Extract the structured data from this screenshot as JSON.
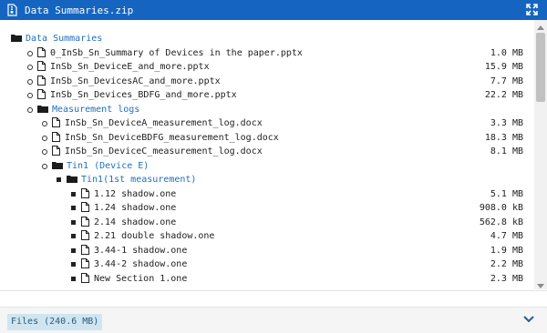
{
  "window": {
    "title": "Data Summaries.zip"
  },
  "tree": [
    {
      "name": "Data Summaries",
      "type": "folder",
      "level": 0
    },
    {
      "name": "0_InSb_Sn_Summary of Devices in the paper.pptx",
      "type": "file",
      "level": 1,
      "size": "1.0 MB"
    },
    {
      "name": "InSb_Sn_DeviceE_and_more.pptx",
      "type": "file",
      "level": 1,
      "size": "15.9 MB"
    },
    {
      "name": "InSb_Sn_DevicesAC_and_more.pptx",
      "type": "file",
      "level": 1,
      "size": "7.7 MB"
    },
    {
      "name": "InSb_Sn_Devices_BDFG_and_more.pptx",
      "type": "file",
      "level": 1,
      "size": "22.2 MB"
    },
    {
      "name": "Measurement logs",
      "type": "folder",
      "level": 1
    },
    {
      "name": "InSb_Sn_DeviceA_measurement_log.docx",
      "type": "file",
      "level": 2,
      "size": "3.3 MB"
    },
    {
      "name": "InSb_Sn_DeviceBDFG_measurement_log.docx",
      "type": "file",
      "level": 2,
      "size": "18.3 MB"
    },
    {
      "name": "InSb_Sn_DeviceC_measurement_log.docx",
      "type": "file",
      "level": 2,
      "size": "8.1 MB"
    },
    {
      "name": "Tin1 (Device E)",
      "type": "folder",
      "level": 2
    },
    {
      "name": "Tin1(1st measurement)",
      "type": "folder",
      "level": 3
    },
    {
      "name": "1.12 shadow.one",
      "type": "file",
      "level": 4,
      "size": "5.1 MB"
    },
    {
      "name": "1.24 shadow.one",
      "type": "file",
      "level": 4,
      "size": "908.0 kB"
    },
    {
      "name": "2.14 shadow.one",
      "type": "file",
      "level": 4,
      "size": "562.8 kB"
    },
    {
      "name": "2.21 double shadow.one",
      "type": "file",
      "level": 4,
      "size": "4.7 MB"
    },
    {
      "name": "3.44-1 shadow.one",
      "type": "file",
      "level": 4,
      "size": "1.9 MB"
    },
    {
      "name": "3.44-2 shadow.one",
      "type": "file",
      "level": 4,
      "size": "2.2 MB"
    },
    {
      "name": "New Section 1.one",
      "type": "file",
      "level": 4,
      "size": "2.3 MB"
    }
  ],
  "footer": {
    "files_label": "Files (240.6 MB)"
  }
}
